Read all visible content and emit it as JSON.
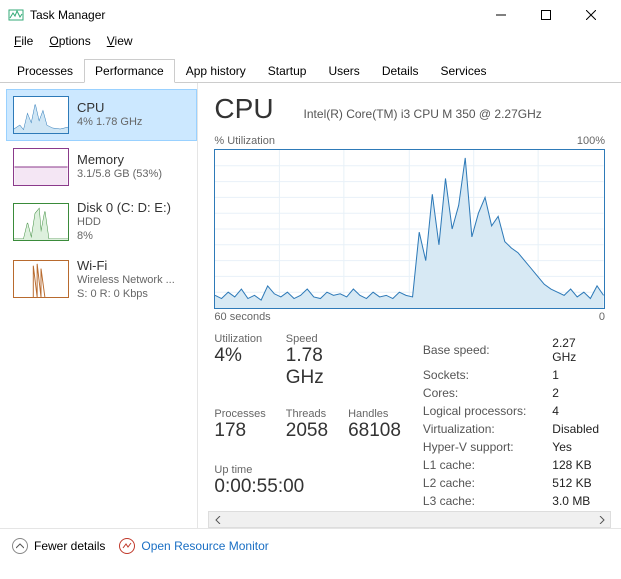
{
  "window": {
    "title": "Task Manager"
  },
  "menu": {
    "file": "File",
    "options": "Options",
    "view": "View"
  },
  "tabs": {
    "processes": "Processes",
    "performance": "Performance",
    "app_history": "App history",
    "startup": "Startup",
    "users": "Users",
    "details": "Details",
    "services": "Services"
  },
  "sidebar": {
    "cpu": {
      "title": "CPU",
      "sub": "4%  1.78 GHz"
    },
    "memory": {
      "title": "Memory",
      "sub": "3.1/5.8 GB (53%)"
    },
    "disk": {
      "title": "Disk 0 (C: D: E:)",
      "sub1": "HDD",
      "sub2": "8%"
    },
    "wifi": {
      "title": "Wi-Fi",
      "sub1": "Wireless Network ...",
      "sub2": "S: 0 R: 0 Kbps"
    }
  },
  "main": {
    "heading": "CPU",
    "model": "Intel(R) Core(TM) i3 CPU M 350 @ 2.27GHz",
    "y_label": "% Utilization",
    "y_max": "100%",
    "x_left": "60 seconds",
    "x_right": "0",
    "stats": {
      "util_label": "Utilization",
      "util_val": "4%",
      "speed_label": "Speed",
      "speed_val": "1.78 GHz",
      "proc_label": "Processes",
      "proc_val": "178",
      "thread_label": "Threads",
      "thread_val": "2058",
      "handle_label": "Handles",
      "handle_val": "68108",
      "uptime_label": "Up time",
      "uptime_val": "0:00:55:00"
    },
    "right": {
      "base_speed_l": "Base speed:",
      "base_speed_v": "2.27 GHz",
      "sockets_l": "Sockets:",
      "sockets_v": "1",
      "cores_l": "Cores:",
      "cores_v": "2",
      "logical_l": "Logical processors:",
      "logical_v": "4",
      "virt_l": "Virtualization:",
      "virt_v": "Disabled",
      "hyperv_l": "Hyper-V support:",
      "hyperv_v": "Yes",
      "l1_l": "L1 cache:",
      "l1_v": "128 KB",
      "l2_l": "L2 cache:",
      "l2_v": "512 KB",
      "l3_l": "L3 cache:",
      "l3_v": "3.0 MB"
    }
  },
  "chart_data": {
    "type": "area",
    "title": "% Utilization",
    "xlabel": "seconds",
    "ylabel": "% Utilization",
    "ylim": [
      0,
      100
    ],
    "xrange_seconds": [
      60,
      0
    ],
    "series": [
      {
        "name": "CPU",
        "values": [
          8,
          6,
          10,
          7,
          12,
          6,
          8,
          5,
          14,
          9,
          7,
          10,
          6,
          8,
          12,
          7,
          6,
          10,
          8,
          9,
          7,
          12,
          8,
          6,
          10,
          7,
          8,
          6,
          10,
          8,
          7,
          48,
          30,
          72,
          40,
          82,
          50,
          65,
          95,
          45,
          60,
          70,
          52,
          58,
          42,
          38,
          35,
          30,
          25,
          20,
          15,
          12,
          10,
          8,
          12,
          7,
          10,
          6,
          14,
          8
        ]
      }
    ]
  },
  "footer": {
    "fewer": "Fewer details",
    "orm": "Open Resource Monitor"
  }
}
